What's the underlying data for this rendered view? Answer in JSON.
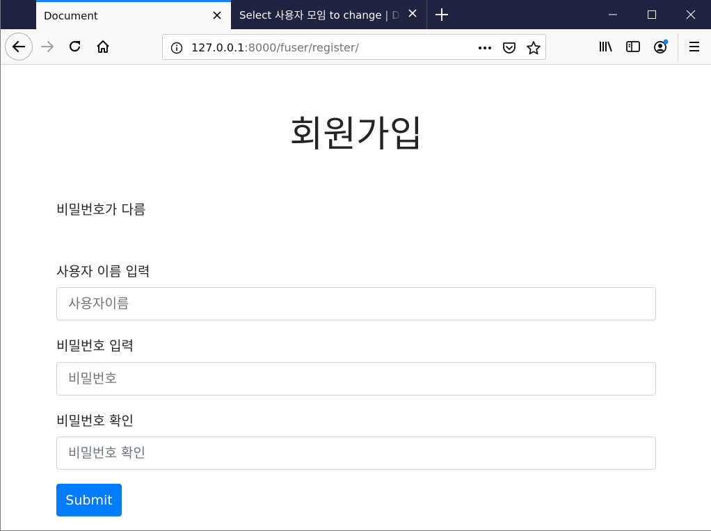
{
  "browser": {
    "tabs": [
      {
        "title": "Document",
        "active": true
      },
      {
        "title": "Select 사용자 모임 to change | Django",
        "active": false
      }
    ],
    "url": {
      "host": "127.0.0.1",
      "path": ":8000/fuser/register/"
    },
    "accent_color": "#0a84ff",
    "icons": [
      "back-icon",
      "forward-icon",
      "reload-icon",
      "home-icon",
      "info-icon",
      "more-icon",
      "pocket-icon",
      "bookmark-star-icon",
      "library-icon",
      "sidebar-icon",
      "account-icon",
      "menu-icon",
      "new-tab-icon",
      "minimize-icon",
      "maximize-icon",
      "close-icon"
    ]
  },
  "page": {
    "title": "회원가입",
    "error_message": "비밀번호가 다름",
    "fields": [
      {
        "label": "사용자 이름 입력",
        "placeholder": "사용자이름",
        "value": ""
      },
      {
        "label": "비밀번호 입력",
        "placeholder": "비밀번호",
        "value": ""
      },
      {
        "label": "비밀번호 확인",
        "placeholder": "비밀번호 확인",
        "value": ""
      }
    ],
    "submit_label": "Submit",
    "submit_color": "#007bff"
  }
}
